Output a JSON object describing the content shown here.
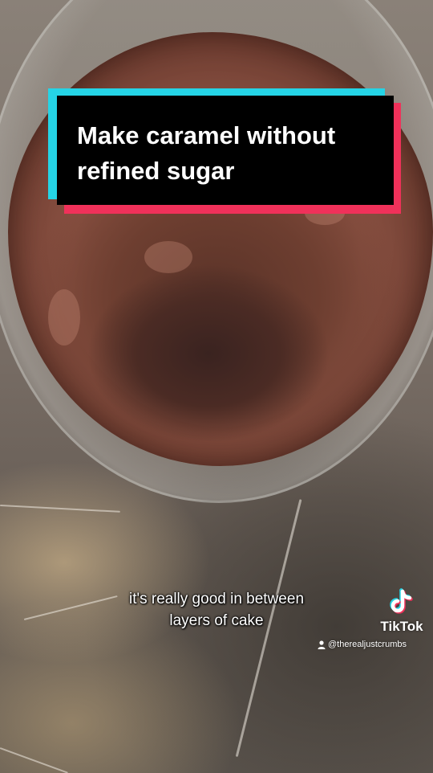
{
  "title_card": {
    "text": "Make caramel without\nrefined sugar"
  },
  "captions": {
    "line1": "it's really good in between",
    "line2": "layers of cake"
  },
  "watermark": {
    "brand": "TikTok",
    "handle": "@therealjustcrumbs",
    "logo_icon": "tiktok-note-icon",
    "user_icon": "user-icon"
  },
  "colors": {
    "title_bg": "#000000",
    "title_accent_cyan": "#25d4e6",
    "title_accent_red": "#f0315a",
    "caramel": "#7a4636"
  }
}
